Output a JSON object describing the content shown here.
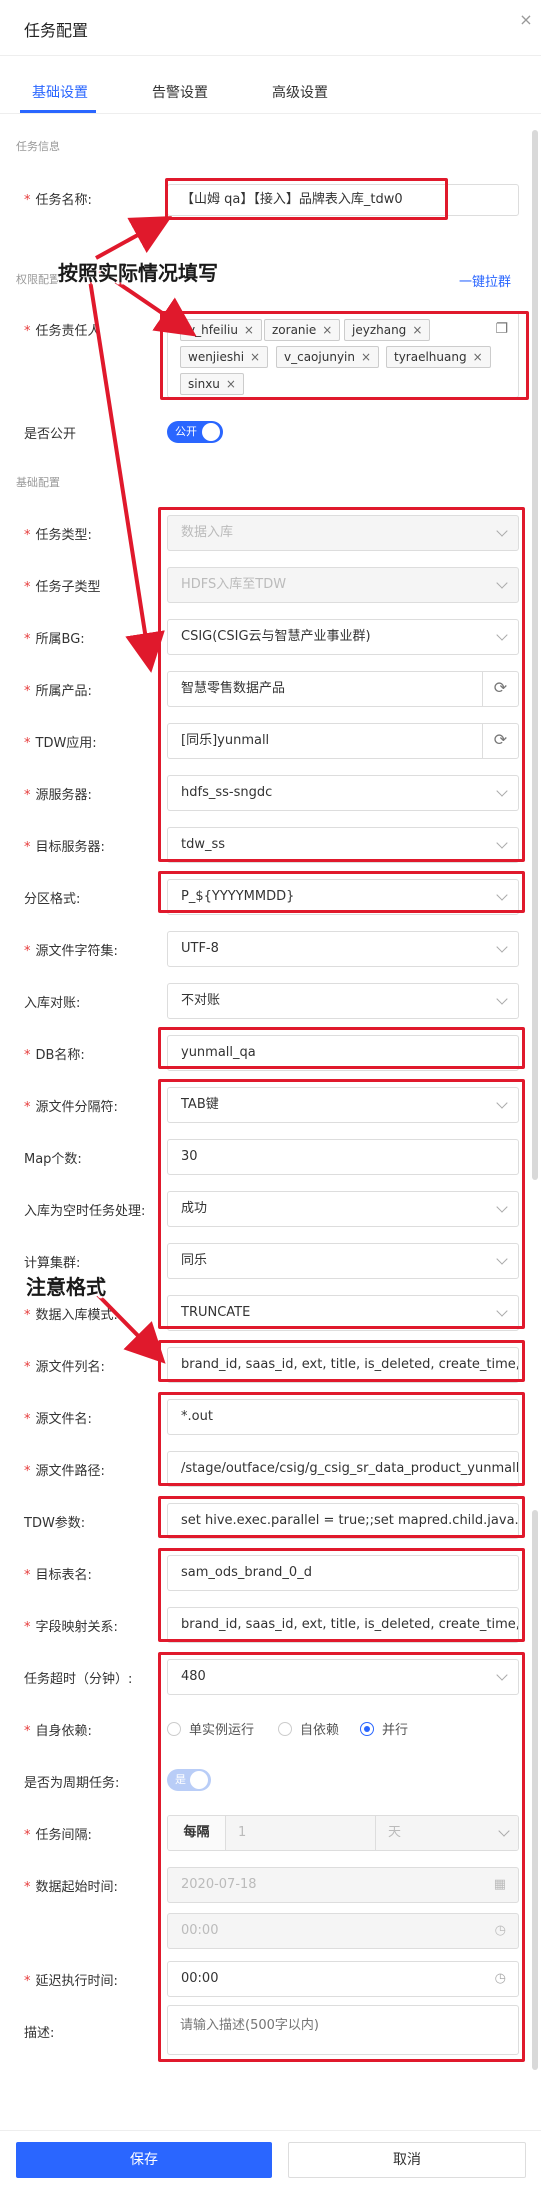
{
  "header": {
    "title": "任务配置",
    "close_icon": "×"
  },
  "tabs": [
    {
      "label": "基础设置"
    },
    {
      "label": "告警设置"
    },
    {
      "label": "高级设置"
    }
  ],
  "sections": {
    "task_info": "任务信息",
    "permission": "权限配置",
    "basic": "基础配置"
  },
  "links": {
    "pull_group": "一键拉群"
  },
  "fields": {
    "task_name": {
      "label": "任务名称:",
      "value": "【山姆 qa】【接入】品牌表入库_tdw0"
    },
    "owners": {
      "label": "任务责任人",
      "tags": [
        "v_hfeiliu",
        "zoranie",
        "jeyzhang",
        "wenjieshi",
        "v_caojunyin",
        "tyraelhuang",
        "sinxu"
      ]
    },
    "is_public": {
      "label": "是否公开",
      "switch": "公开"
    },
    "task_type": {
      "label": "任务类型:",
      "value": "数据入库"
    },
    "task_subtype": {
      "label": "任务子类型",
      "value": "HDFS入库至TDW"
    },
    "bg": {
      "label": "所属BG:",
      "value": "CSIG(CSIG云与智慧产业事业群)"
    },
    "product": {
      "label": "所属产品:",
      "value": "智慧零售数据产品"
    },
    "tdw_app": {
      "label": "TDW应用:",
      "value": "[同乐]yunmall"
    },
    "src_server": {
      "label": "源服务器:",
      "value": "hdfs_ss-sngdc"
    },
    "dst_server": {
      "label": "目标服务器:",
      "value": "tdw_ss"
    },
    "partition": {
      "label": "分区格式:",
      "value": "P_${YYYYMMDD}"
    },
    "charset": {
      "label": "源文件字符集:",
      "value": "UTF-8"
    },
    "reconcile": {
      "label": "入库对账:",
      "value": "不对账"
    },
    "db_name": {
      "label": "DB名称:",
      "value": "yunmall_qa"
    },
    "separator": {
      "label": "源文件分隔符:",
      "value": "TAB键"
    },
    "map_count": {
      "label": "Map个数:",
      "value": "30"
    },
    "empty_handle": {
      "label": "入库为空时任务处理:",
      "value": "成功"
    },
    "cluster": {
      "label": "计算集群:",
      "value": "同乐"
    },
    "load_mode": {
      "label": "数据入库模式:",
      "value": "TRUNCATE"
    },
    "columns": {
      "label": "源文件列名:",
      "value": "brand_id, saas_id, ext, title, is_deleted, create_time, up"
    },
    "file_name": {
      "label": "源文件名:",
      "value": "*.out"
    },
    "file_path": {
      "label": "源文件路径:",
      "value": "/stage/outface/csig/g_csig_sr_data_product_yunmall/"
    },
    "tdw_params": {
      "label": "TDW参数:",
      "value": "set hive.exec.parallel = true;;set mapred.child.java.opt"
    },
    "target_table": {
      "label": "目标表名:",
      "value": "sam_ods_brand_0_d"
    },
    "field_map": {
      "label": "字段映射关系:",
      "value": "brand_id, saas_id, ext, title, is_deleted, create_time, up"
    },
    "timeout": {
      "label": "任务超时（分钟）:",
      "value": "480"
    },
    "self_dep": {
      "label": "自身依赖:",
      "options": [
        "单实例运行",
        "自依赖",
        "并行"
      ],
      "selected": "并行"
    },
    "periodic": {
      "label": "是否为周期任务:",
      "switch": "是"
    },
    "interval": {
      "label": "任务间隔:",
      "prefix": "每隔",
      "value": "1",
      "unit": "天"
    },
    "start_time": {
      "label": "数据起始时间:",
      "date": "2020-07-18",
      "time": "00:00"
    },
    "delay": {
      "label": "延迟执行时间:",
      "value": "00:00"
    },
    "desc": {
      "label": "描述:",
      "placeholder": "请输入描述(500字以内)"
    }
  },
  "annotations": {
    "fill_note": "按照实际情况填写",
    "format_note": "注意格式"
  },
  "buttons": {
    "save": "保存",
    "cancel": "取消"
  },
  "colors": {
    "accent": "#2a66ff",
    "annotation_red": "#e0192c",
    "required": "#e63b3b"
  }
}
